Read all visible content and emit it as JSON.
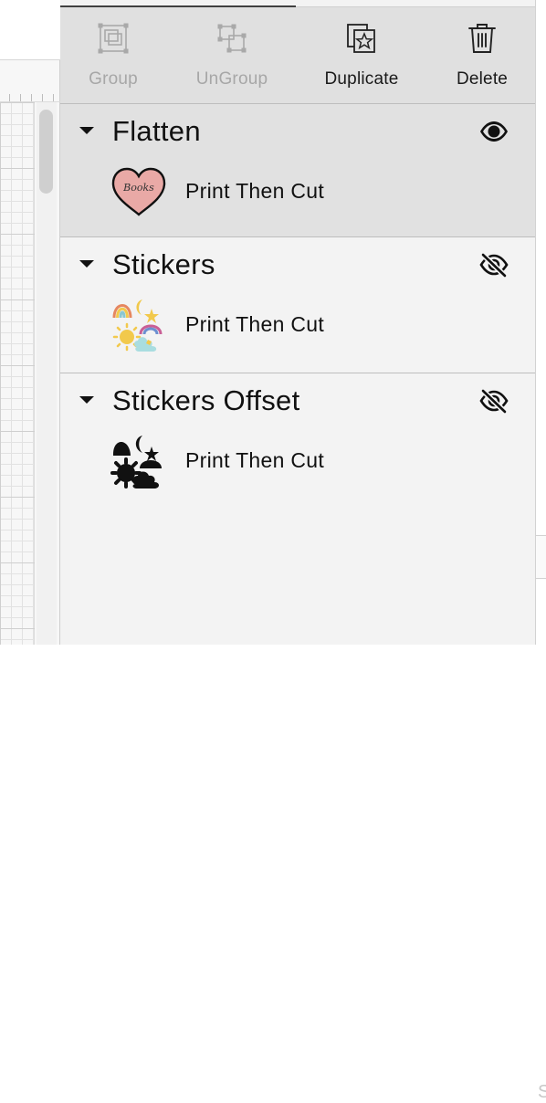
{
  "toolbar": {
    "group": {
      "label": "Group",
      "icon": "group-icon",
      "enabled": false
    },
    "ungroup": {
      "label": "UnGroup",
      "icon": "ungroup-icon",
      "enabled": false
    },
    "duplicate": {
      "label": "Duplicate",
      "icon": "duplicate-icon",
      "enabled": true
    },
    "delete": {
      "label": "Delete",
      "icon": "trash-icon",
      "enabled": true
    }
  },
  "layers": [
    {
      "title": "Flatten",
      "visible": true,
      "selected": true,
      "items": [
        {
          "label": "Print Then Cut",
          "thumbnail": "heart-books-thumbnail",
          "thumbnail_text": "Books"
        }
      ]
    },
    {
      "title": "Stickers",
      "visible": false,
      "selected": false,
      "items": [
        {
          "label": "Print Then Cut",
          "thumbnail": "color-stickers-thumbnail"
        }
      ]
    },
    {
      "title": "Stickers Offset",
      "visible": false,
      "selected": false,
      "items": [
        {
          "label": "Print Then Cut",
          "thumbnail": "black-silhouette-thumbnail"
        }
      ]
    }
  ],
  "right_edge": {
    "partial_glyph": "S"
  },
  "colors": {
    "toolbar_bg": "#e0e0e0",
    "selected_layer_bg": "#e1e1e1",
    "panel_bg": "#f3f3f3",
    "disabled_text": "#a7a7a7",
    "heart_fill": "#e9a9a6"
  }
}
